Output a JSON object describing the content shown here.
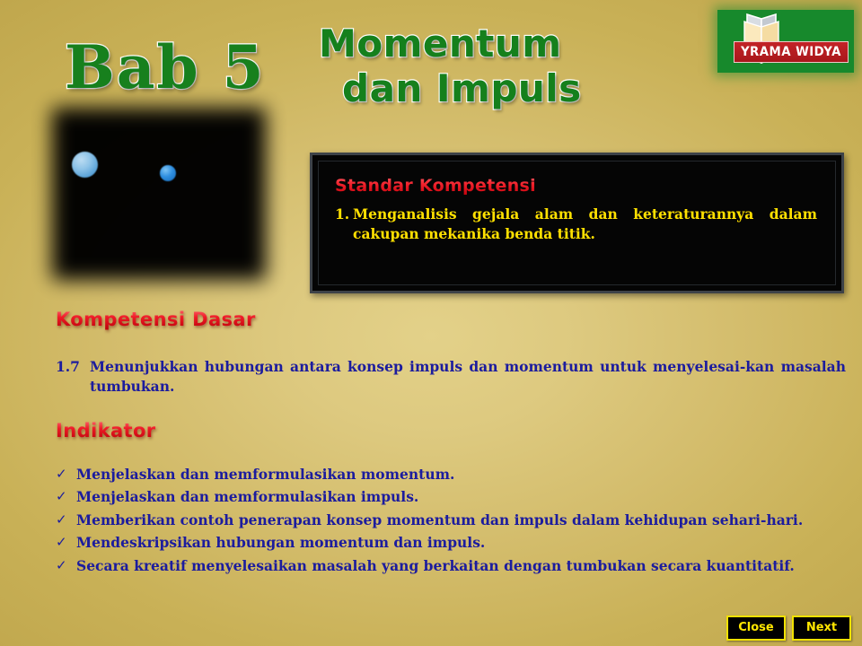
{
  "slide": {
    "chapter_label": "Bab 5",
    "title_line1": "Momentum",
    "title_line2": "dan Impuls"
  },
  "logo": {
    "name": "yrama-widya-logo",
    "text": "YRAMA WIDYA",
    "green": "#17892c",
    "red": "#c32327"
  },
  "illustration": {
    "name": "collision-illustration",
    "description": "two colliding spheres"
  },
  "standar_kompetensi": {
    "heading": "Standar Kompetensi",
    "items": [
      {
        "number": "1.",
        "text": "Menganalisis gejala alam dan keteraturannya dalam cakupan mekanika benda titik."
      }
    ]
  },
  "kompetensi_dasar": {
    "heading": "Kompetensi Dasar",
    "items": [
      {
        "number": "1.7",
        "text": "Menunjukkan hubungan antara konsep impuls dan momentum untuk menyelesai-kan masalah tumbukan."
      }
    ]
  },
  "indikator": {
    "heading": "Indikator",
    "bullet_glyph": "✓",
    "items": [
      "Menjelaskan dan memformulasikan momentum.",
      "Menjelaskan dan memformulasikan impuls.",
      "Memberikan contoh penerapan konsep momentum dan impuls dalam kehidupan sehari-hari.",
      "Mendeskripsikan hubungan momentum dan impuls.",
      "Secara kreatif menyelesaikan masalah yang berkaitan dengan tumbukan secara kuantitatif."
    ]
  },
  "navigation": {
    "close_label": "Close",
    "next_label": "Next"
  },
  "colors": {
    "background_light": "#e3d189",
    "background_dark": "#bfa64c",
    "title_green": "#17801d",
    "heading_red": "#ee1b26",
    "body_blue": "#1c1c9e",
    "box_yellow_text": "#ffe000"
  }
}
